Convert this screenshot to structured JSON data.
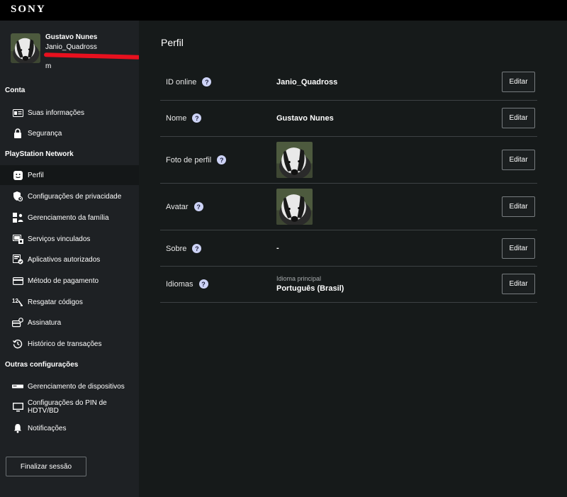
{
  "brand": "SONY",
  "user": {
    "name": "Gustavo Nunes",
    "online_id": "Janio_Quadross",
    "email_tail": "m"
  },
  "sidebar": {
    "section_account": "Conta",
    "section_psn": "PlayStation Network",
    "section_other": "Outras configurações",
    "items": [
      {
        "label": "Suas informações",
        "icon": "id-card-icon"
      },
      {
        "label": "Segurança",
        "icon": "lock-icon"
      },
      {
        "label": "Perfil",
        "icon": "face-icon"
      },
      {
        "label": "Configurações de privacidade",
        "icon": "privacy-shield-icon"
      },
      {
        "label": "Gerenciamento da família",
        "icon": "family-icon"
      },
      {
        "label": "Serviços vinculados",
        "icon": "linked-services-icon"
      },
      {
        "label": "Aplicativos autorizados",
        "icon": "authorized-apps-icon"
      },
      {
        "label": "Método de pagamento",
        "icon": "credit-card-icon"
      },
      {
        "label": "Resgatar códigos",
        "icon": "redeem-codes-icon"
      },
      {
        "label": "Assinatura",
        "icon": "subscription-icon"
      },
      {
        "label": "Histórico de transações",
        "icon": "history-icon"
      },
      {
        "label": "Gerenciamento de dispositivos",
        "icon": "device-icon"
      },
      {
        "label": "Configurações do PIN de HDTV/BD",
        "icon": "tv-icon"
      },
      {
        "label": "Notificações",
        "icon": "bell-icon"
      }
    ],
    "signout_label": "Finalizar sessão"
  },
  "main": {
    "title": "Perfil",
    "edit_label": "Editar",
    "rows": [
      {
        "label": "ID online",
        "value": "Janio_Quadross"
      },
      {
        "label": "Nome",
        "value": "Gustavo Nunes"
      },
      {
        "label": "Foto de perfil",
        "value": ""
      },
      {
        "label": "Avatar",
        "value": ""
      },
      {
        "label": "Sobre",
        "value": "-"
      },
      {
        "label": "Idiomas",
        "sublabel": "Idioma principal",
        "value": "Português (Brasil)"
      }
    ]
  },
  "colors": {
    "sidebar_bg": "#1e2124",
    "main_bg": "#161a1a",
    "help_icon": "#cdd3f6",
    "redaction": "#e8101e"
  }
}
